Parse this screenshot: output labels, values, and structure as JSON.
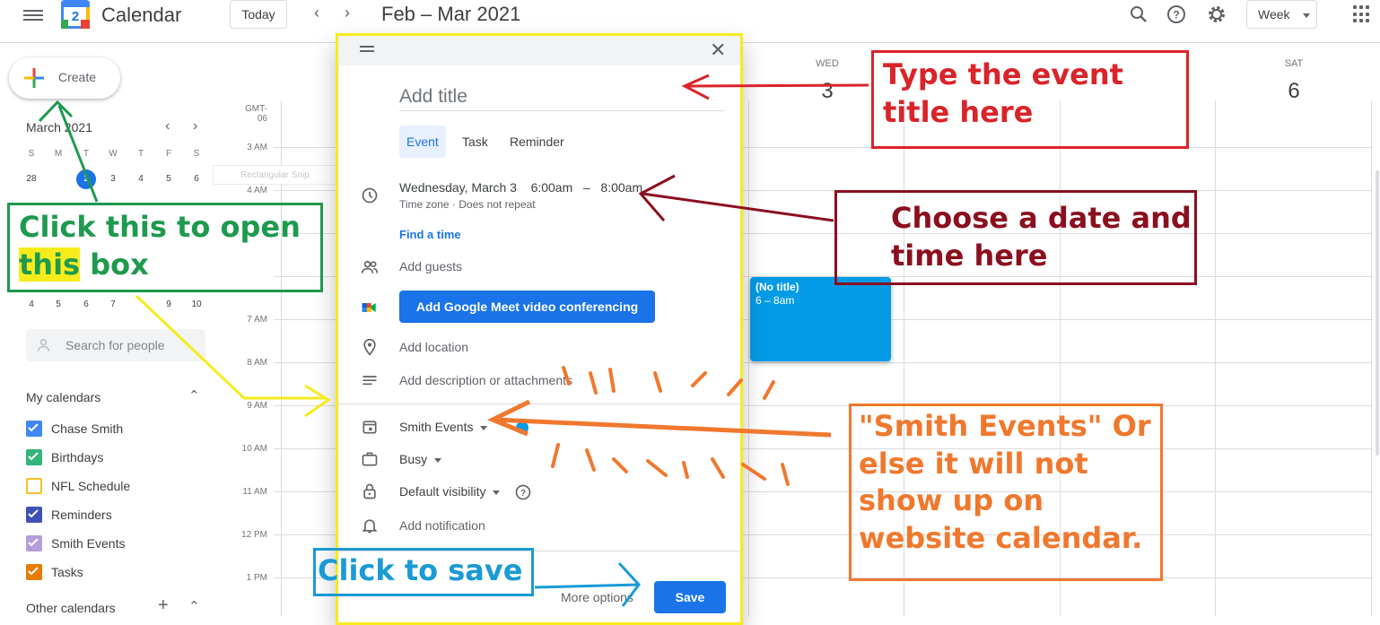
{
  "app": {
    "title": "Calendar",
    "logo_day": "2",
    "today_label": "Today",
    "date_range": "Feb – Mar 2021",
    "view_label": "Week"
  },
  "sidebar": {
    "create_label": "Create",
    "mini_month": "March 2021",
    "weekdays": [
      "S",
      "M",
      "T",
      "W",
      "T",
      "F",
      "S"
    ],
    "week1": [
      "28",
      "",
      "2",
      "3",
      "4",
      "5",
      "6"
    ],
    "week_last": [
      "4",
      "5",
      "6",
      "7",
      "",
      "9",
      "10"
    ],
    "search_placeholder": "Search for people",
    "my_calendars_title": "My calendars",
    "my_calendars": [
      {
        "label": "Chase Smith",
        "color": "#4285f4",
        "checked": true
      },
      {
        "label": "Birthdays",
        "color": "#33b679",
        "checked": true
      },
      {
        "label": "NFL Schedule",
        "color": "#f6bf26",
        "checked": false
      },
      {
        "label": "Reminders",
        "color": "#3f51b5",
        "checked": true
      },
      {
        "label": "Smith Events",
        "color": "#b39ddb",
        "checked": true
      },
      {
        "label": "Tasks",
        "color": "#e67c00",
        "checked": true
      }
    ],
    "other_calendars_title": "Other calendars"
  },
  "grid": {
    "timezone": "GMT-06",
    "times": [
      "3 AM",
      "4 AM",
      "7 AM",
      "8 AM",
      "9 AM",
      "10 AM",
      "11 AM",
      "12 PM",
      "1 PM"
    ],
    "days": [
      {
        "dow": "WED",
        "num": "3"
      },
      {
        "dow": "SAT",
        "num": "6"
      }
    ],
    "event": {
      "title": "(No title)",
      "time": "6 – 8am"
    },
    "snip_label": "Rectangular Snip"
  },
  "dialog": {
    "title_placeholder": "Add title",
    "tabs": [
      "Event",
      "Task",
      "Reminder"
    ],
    "date": "Wednesday, March 3",
    "start_time": "6:00am",
    "time_dash": "–",
    "end_time": "8:00am",
    "timezone_note": "Time zone · Does not repeat",
    "find_time": "Find a time",
    "add_guests": "Add guests",
    "meet_button": "Add Google Meet video conferencing",
    "add_location": "Add location",
    "add_description": "Add description or attachments",
    "calendar_select": "Smith Events",
    "busy_select": "Busy",
    "visibility_select": "Default visibility",
    "add_notification": "Add notification",
    "more_options": "More options",
    "save": "Save"
  },
  "annotations": {
    "title_note": "Type the event title here",
    "date_note": "Choose a date and time here",
    "create_note_a": "Click this to open",
    "create_note_hl": "this",
    "create_note_b": "box",
    "smith_note": "\"Smith Events\" Or else it will not show up on website calendar.",
    "save_note": "Click to save",
    "colors": {
      "red": "#d9242a",
      "maroon": "#8b0f1e",
      "green": "#1e9a4e",
      "orange": "#f0782d",
      "blue": "#1a9ad6",
      "yellow": "#f6ec1c"
    }
  }
}
